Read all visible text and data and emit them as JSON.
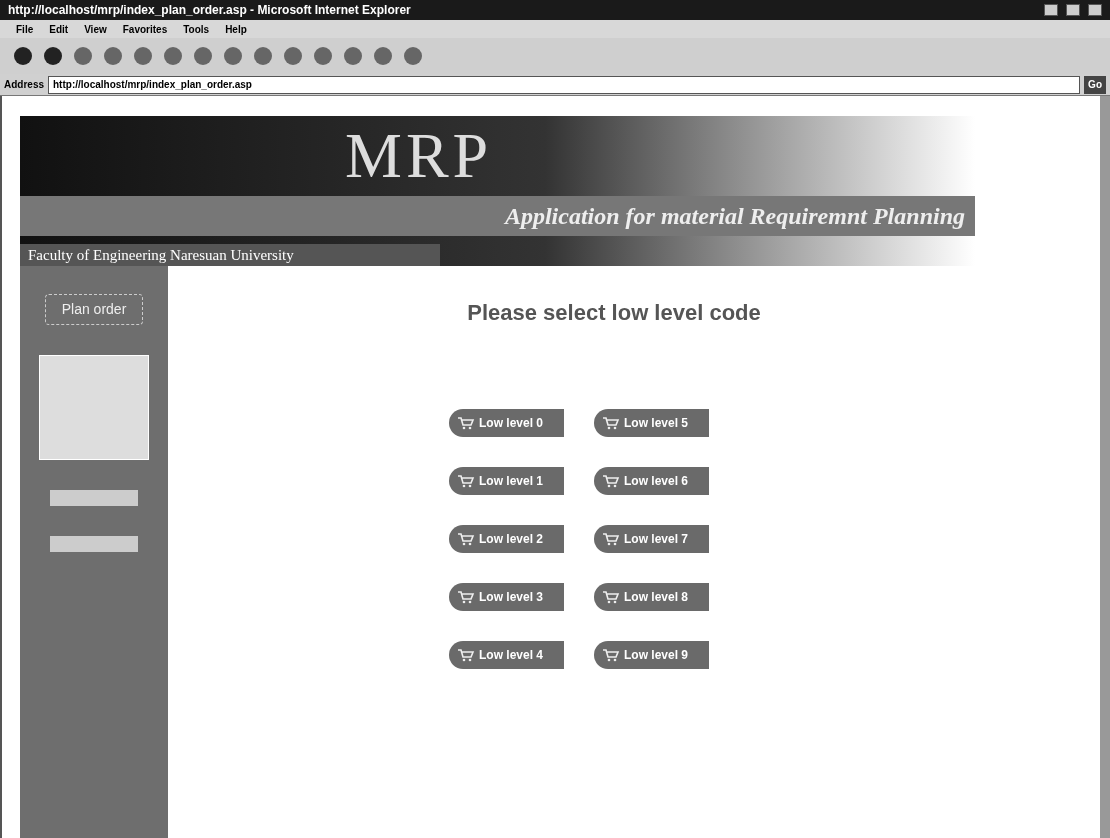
{
  "window": {
    "title": "http://localhost/mrp/index_plan_order.asp - Microsoft Internet Explorer"
  },
  "menu": [
    "File",
    "Edit",
    "View",
    "Favorites",
    "Tools",
    "Help"
  ],
  "address_bar": {
    "label": "Address",
    "value": "http://localhost/mrp/index_plan_order.asp",
    "go": "Go"
  },
  "banner": {
    "logo": "MRP",
    "subtitle": "Application for material Requiremnt Planning",
    "faculty": "Faculty of Engineering Naresuan University"
  },
  "sidebar": {
    "button": "Plan order"
  },
  "heading": "Please select low level code",
  "level_buttons": [
    [
      "Low level 0",
      "Low level 1",
      "Low level 2",
      "Low level 3",
      "Low level 4"
    ],
    [
      "Low level 5",
      "Low level 6",
      "Low level 7",
      "Low level 8",
      "Low level 9"
    ]
  ]
}
